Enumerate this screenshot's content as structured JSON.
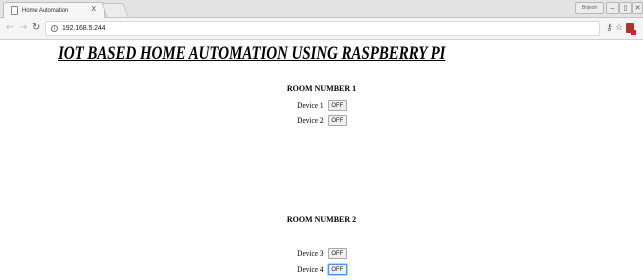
{
  "browser": {
    "tab_title": "Home Automation",
    "tab_close": "X",
    "url": "192.168.5.244",
    "profile_label": "Brijesh",
    "window_controls": [
      "–",
      "▯",
      "✕"
    ],
    "icons": {
      "back": "back-arrow-icon",
      "forward": "forward-arrow-icon",
      "reload": "reload-icon",
      "info": "info-icon",
      "key": "key-icon",
      "star": "star-icon",
      "extension": "extension-icon"
    }
  },
  "page": {
    "title": "IOT BASED HOME AUTOMATION USING RASPBERRY PI",
    "rooms": [
      {
        "heading": "ROOM NUMBER 1",
        "devices": [
          {
            "label": "Device 1",
            "state": "OFF"
          },
          {
            "label": "Device 2",
            "state": "OFF"
          }
        ]
      },
      {
        "heading": "ROOM NUMBER 2",
        "devices": [
          {
            "label": "Device 3",
            "state": "OFF"
          },
          {
            "label": "Device 4",
            "state": "OFF"
          }
        ]
      }
    ]
  },
  "colors": {
    "focus_ring": "#4d90fe",
    "tabstrip_bg": "#e3e3e3",
    "toolbar_bg": "#f5f5f5"
  }
}
